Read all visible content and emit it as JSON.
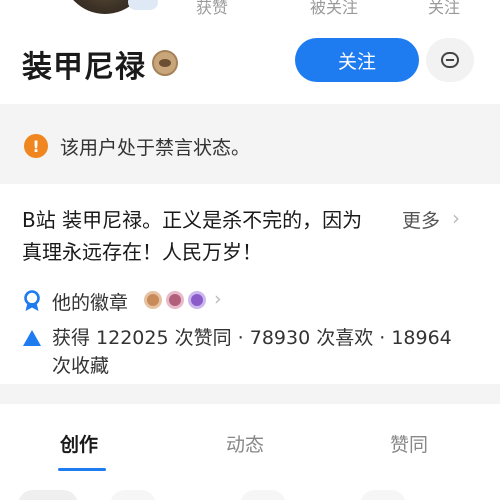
{
  "header": {
    "stats": [
      "获赞",
      "被关注",
      "关注"
    ]
  },
  "profile": {
    "username": "装甲尼禄",
    "follow_label": "关注",
    "level_icon": "level-badge-icon",
    "message_icon": "message-icon"
  },
  "notice": {
    "icon": "warning-icon",
    "icon_glyph": "!",
    "text": "该用户处于禁言状态。"
  },
  "bio": {
    "text": "B站 装甲尼禄。正义是杀不完的，因为真理永远存在！人民万岁！",
    "more_label": "更多",
    "chevron": "›"
  },
  "medals": {
    "label": "他的徽章",
    "chevron": "›",
    "colors": [
      "#c98a5a",
      "#b0607a",
      "#8a5cc9"
    ]
  },
  "stats": {
    "text": "获得 122025 次赞同 · 78930 次喜欢 · 18964 次收藏"
  },
  "tabs": {
    "items": [
      "创作",
      "动态",
      "赞同"
    ],
    "active": "创作"
  },
  "colors": {
    "accent": "#1f7bf0",
    "warning": "#f0861f"
  }
}
